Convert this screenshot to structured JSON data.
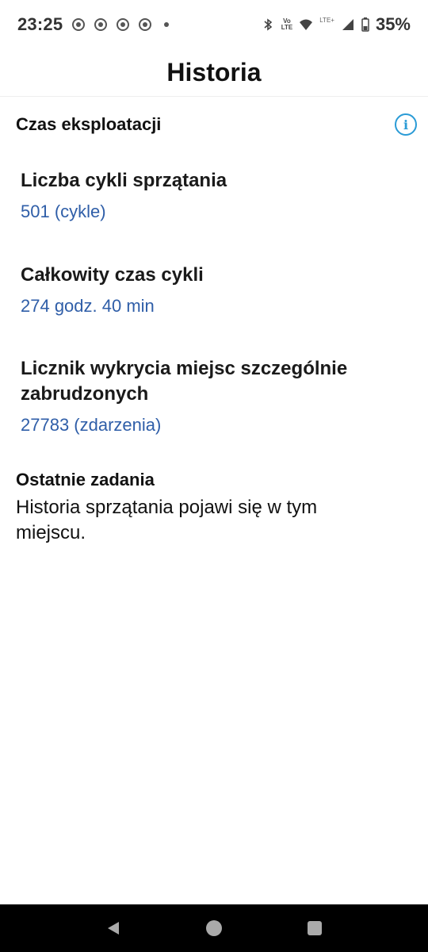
{
  "status_bar": {
    "time": "23:25",
    "battery": "35%",
    "volte_top": "Vo",
    "volte_bottom": "LTE",
    "lte_plus": "LTE+",
    "notification_icons": [
      "chrome-icon",
      "chrome-icon",
      "chrome-icon",
      "chrome-icon"
    ]
  },
  "header": {
    "title": "Historia"
  },
  "runtime": {
    "section_title": "Czas eksploatacji",
    "stats": [
      {
        "label": "Liczba cykli sprzątania",
        "value": "501 (cykle)"
      },
      {
        "label": "Całkowity czas cykli",
        "value": "274 godz. 40 min"
      },
      {
        "label": "Licznik wykrycia miejsc szczególnie zabrudzonych",
        "value": "27783 (zdarzenia)"
      }
    ]
  },
  "recent": {
    "title": "Ostatnie zadania",
    "text": "Historia sprzątania pojawi się w tym miejscu."
  },
  "colors": {
    "accent": "#2a9bd6",
    "value_text": "#2f5ea8"
  }
}
